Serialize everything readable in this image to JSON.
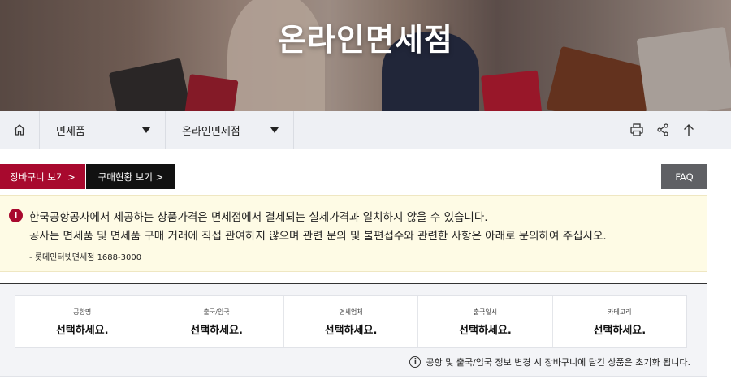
{
  "hero": {
    "title": "온라인면세점"
  },
  "nav": {
    "select1": "면세품",
    "select2": "온라인면세점",
    "icons": [
      "home-icon",
      "print-icon",
      "share-icon",
      "arrow-up-icon"
    ]
  },
  "buttons": {
    "cart": "장바구니 보기 >",
    "status": "구매현황 보기 >",
    "faq": "FAQ"
  },
  "notice": {
    "line1": "한국공항공사에서 제공하는 상품가격은 면세점에서 결제되는 실제가격과 일치하지 않을 수 있습니다.",
    "line2": "공사는 면세품 및 면세품 구매 거래에 직접 관여하지 않으며 관련 문의 및 불편접수와 관련한 사항은 아래로 문의하여 주십시오.",
    "contact": "- 롯데인터넷면세점 1688-3000",
    "accent": "#a8092e"
  },
  "filters": [
    {
      "label": "공항명",
      "value": "선택하세요."
    },
    {
      "label": "출국/입국",
      "value": "선택하세요."
    },
    {
      "label": "면세업체",
      "value": "선택하세요."
    },
    {
      "label": "출국일시",
      "value": "선택하세요."
    },
    {
      "label": "카테고리",
      "value": "선택하세요."
    }
  ],
  "filter_note": "공항 및 출국/입국 정보 변경 시 장바구니에 담긴 상품은 초기화 됩니다."
}
